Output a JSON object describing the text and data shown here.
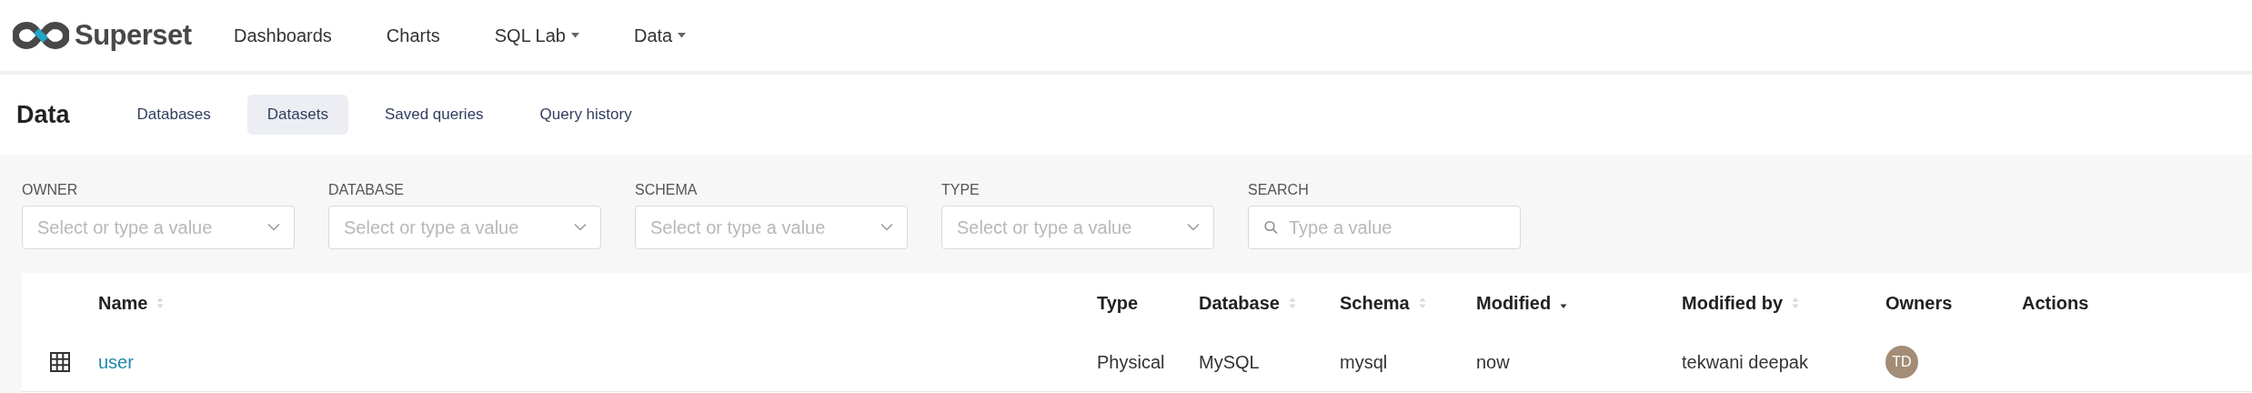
{
  "brand": {
    "name": "Superset"
  },
  "nav": [
    {
      "label": "Dashboards",
      "dropdown": false
    },
    {
      "label": "Charts",
      "dropdown": false
    },
    {
      "label": "SQL Lab",
      "dropdown": true
    },
    {
      "label": "Data",
      "dropdown": true
    }
  ],
  "page_title": "Data",
  "tabs": [
    {
      "label": "Databases",
      "selected": false
    },
    {
      "label": "Datasets",
      "selected": true
    },
    {
      "label": "Saved queries",
      "selected": false
    },
    {
      "label": "Query history",
      "selected": false
    }
  ],
  "filters": [
    {
      "label": "OWNER",
      "kind": "select",
      "placeholder": "Select or type a value"
    },
    {
      "label": "DATABASE",
      "kind": "select",
      "placeholder": "Select or type a value"
    },
    {
      "label": "SCHEMA",
      "kind": "select",
      "placeholder": "Select or type a value"
    },
    {
      "label": "TYPE",
      "kind": "select",
      "placeholder": "Select or type a value"
    },
    {
      "label": "SEARCH",
      "kind": "search",
      "placeholder": "Type a value"
    }
  ],
  "table": {
    "columns": [
      {
        "label": "Name",
        "sortable": true,
        "sorted_descending": false
      },
      {
        "label": "Type"
      },
      {
        "label": "Database",
        "sortable": true,
        "sorted_descending": false
      },
      {
        "label": "Schema",
        "sortable": true,
        "sorted_descending": false
      },
      {
        "label": "Modified",
        "sortable": true,
        "sorted_descending": true
      },
      {
        "label": "Modified by",
        "sortable": true,
        "sorted_descending": false
      },
      {
        "label": "Owners"
      },
      {
        "label": "Actions"
      }
    ],
    "rows": [
      {
        "name": "user",
        "type": "Physical",
        "database": "MySQL",
        "schema": "mysql",
        "modified": "now",
        "modified_by": "tekwani deepak",
        "owners": [
          {
            "initials": "TD",
            "color": "#a38d76"
          }
        ]
      }
    ]
  }
}
